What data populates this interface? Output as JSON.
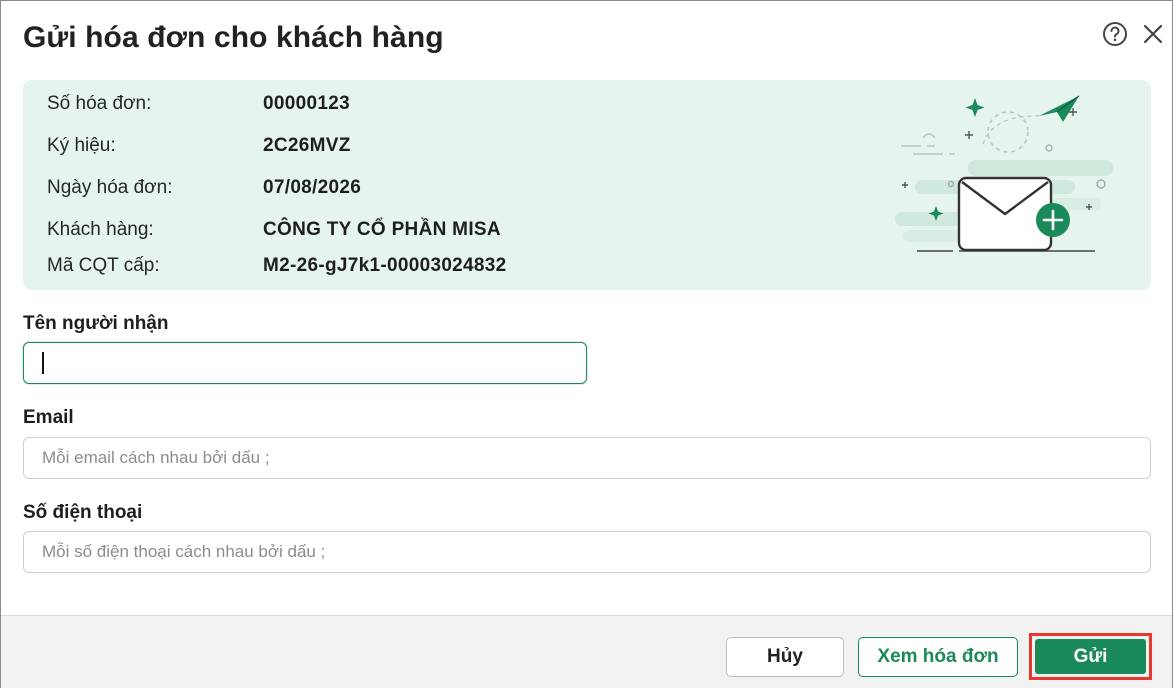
{
  "dialog": {
    "title": "Gửi hóa đơn cho khách hàng",
    "help_icon": "question-circle-icon",
    "close_icon": "close-icon"
  },
  "invoice": {
    "rows": [
      {
        "label": "Số hóa đơn:",
        "value": "00000123"
      },
      {
        "label": "Ký hiệu:",
        "value": "2C26MVZ"
      },
      {
        "label": "Ngày hóa đơn:",
        "value": "07/08/2026"
      },
      {
        "label": "Khách hàng:",
        "value": "CÔNG TY CỔ PHẦN MISA"
      },
      {
        "label": "Mã CQT cấp:",
        "value": "M2-26-gJ7k1-00003024832"
      }
    ],
    "illustration_icon": "envelope-send-illustration-icon"
  },
  "form": {
    "recipient": {
      "label": "Tên người nhận",
      "value": "",
      "placeholder": ""
    },
    "email": {
      "label": "Email",
      "value": "",
      "placeholder": "Mỗi email cách nhau bởi dấu ;"
    },
    "phone": {
      "label": "Số điện thoại",
      "value": "",
      "placeholder": "Mỗi số điện thoại cách nhau bởi dấu ;"
    }
  },
  "footer": {
    "cancel_label": "Hủy",
    "view_label": "Xem hóa đơn",
    "send_label": "Gửi"
  },
  "colors": {
    "accent": "#1b8a5a",
    "info_bg": "#e6f4ee",
    "highlight": "#e8372c"
  }
}
